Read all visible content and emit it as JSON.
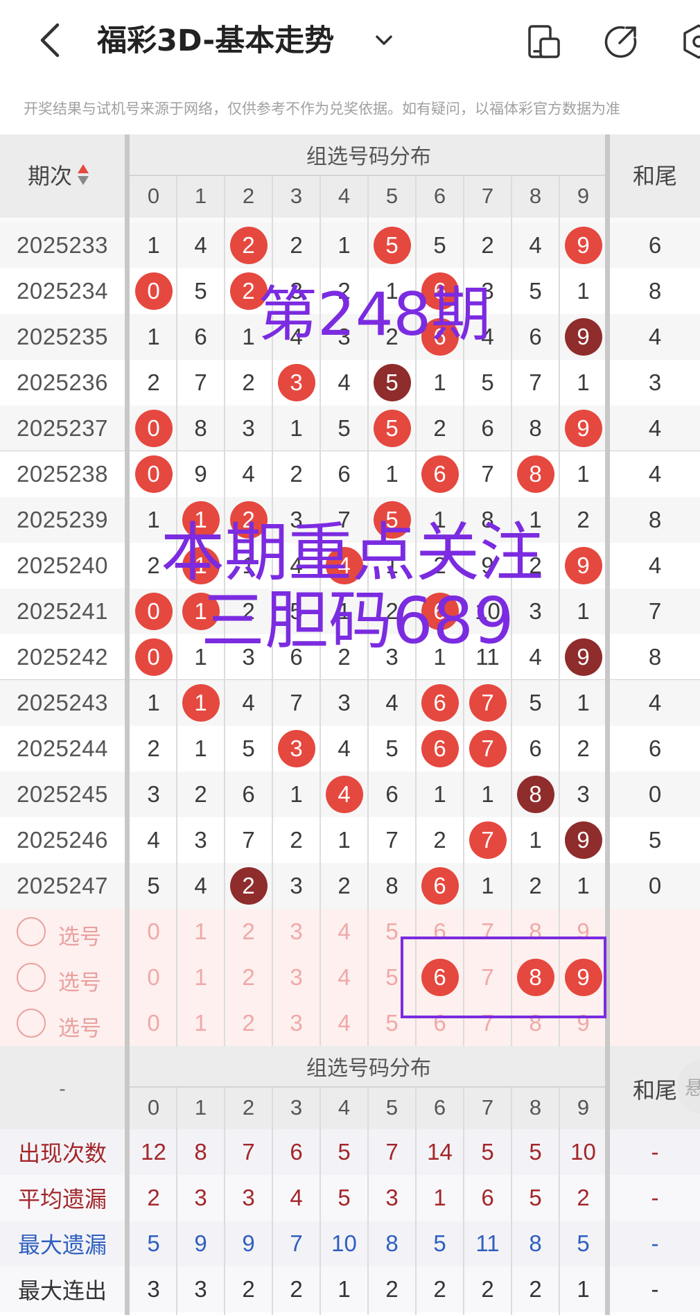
{
  "header": {
    "title": "福彩3D-基本走势",
    "back_icon": "chevron-left-icon",
    "caret_icon": "chevron-down-icon",
    "icons": [
      "phone-icon",
      "share-icon",
      "settings-icon"
    ]
  },
  "notice": "开奖结果与试机号来源于网络，仅供参考不作为兑奖依据。如有疑问，以福体彩官方数据为准",
  "table": {
    "col_issue": "期次",
    "group_title": "组选号码分布",
    "col_tail": "和尾",
    "digits": [
      "0",
      "1",
      "2",
      "3",
      "4",
      "5",
      "6",
      "7",
      "8",
      "9"
    ],
    "rows": [
      {
        "issue": "2025233",
        "cells": [
          "1",
          "4",
          "2",
          "2",
          "1",
          "5",
          "5",
          "2",
          "4",
          "9"
        ],
        "balls": [
          2,
          5,
          9
        ],
        "dark": [],
        "tail": "6"
      },
      {
        "issue": "2025234",
        "cells": [
          "0",
          "5",
          "2",
          "3",
          "2",
          "1",
          "6",
          "3",
          "5",
          "1"
        ],
        "balls": [
          0,
          2,
          6
        ],
        "dark": [],
        "tail": "8"
      },
      {
        "issue": "2025235",
        "cells": [
          "1",
          "6",
          "1",
          "4",
          "3",
          "2",
          "6",
          "4",
          "6",
          "9"
        ],
        "balls": [
          6,
          9
        ],
        "dark": [
          9
        ],
        "tail": "4"
      },
      {
        "issue": "2025236",
        "cells": [
          "2",
          "7",
          "2",
          "3",
          "4",
          "5",
          "1",
          "5",
          "7",
          "1"
        ],
        "balls": [
          3,
          5
        ],
        "dark": [
          5
        ],
        "tail": "3"
      },
      {
        "issue": "2025237",
        "cells": [
          "0",
          "8",
          "3",
          "1",
          "5",
          "5",
          "2",
          "6",
          "8",
          "9"
        ],
        "balls": [
          0,
          5,
          9
        ],
        "dark": [],
        "tail": "4"
      },
      {
        "issue": "2025238",
        "cells": [
          "0",
          "9",
          "4",
          "2",
          "6",
          "1",
          "6",
          "7",
          "8",
          "1"
        ],
        "balls": [
          0,
          6,
          8
        ],
        "dark": [],
        "tail": "4"
      },
      {
        "issue": "2025239",
        "cells": [
          "1",
          "1",
          "2",
          "3",
          "7",
          "5",
          "1",
          "8",
          "1",
          "2"
        ],
        "balls": [
          1,
          2,
          5
        ],
        "dark": [],
        "tail": "8"
      },
      {
        "issue": "2025240",
        "cells": [
          "2",
          "1",
          "1",
          "4",
          "4",
          "1",
          "2",
          "9",
          "2",
          "9"
        ],
        "balls": [
          1,
          4,
          9
        ],
        "dark": [],
        "tail": "4"
      },
      {
        "issue": "2025241",
        "cells": [
          "0",
          "1",
          "2",
          "5",
          "1",
          "2",
          "6",
          "10",
          "3",
          "1"
        ],
        "balls": [
          0,
          1,
          6
        ],
        "dark": [],
        "tail": "7"
      },
      {
        "issue": "2025242",
        "cells": [
          "0",
          "1",
          "3",
          "6",
          "2",
          "3",
          "1",
          "11",
          "4",
          "9"
        ],
        "balls": [
          0,
          9
        ],
        "dark": [
          9
        ],
        "tail": "8"
      },
      {
        "issue": "2025243",
        "cells": [
          "1",
          "1",
          "4",
          "7",
          "3",
          "4",
          "6",
          "7",
          "5",
          "1"
        ],
        "balls": [
          1,
          6,
          7
        ],
        "dark": [],
        "tail": "4"
      },
      {
        "issue": "2025244",
        "cells": [
          "2",
          "1",
          "5",
          "3",
          "4",
          "5",
          "6",
          "7",
          "6",
          "2"
        ],
        "balls": [
          3,
          6,
          7
        ],
        "dark": [],
        "tail": "6"
      },
      {
        "issue": "2025245",
        "cells": [
          "3",
          "2",
          "6",
          "1",
          "4",
          "6",
          "1",
          "1",
          "8",
          "3"
        ],
        "balls": [
          4,
          8
        ],
        "dark": [
          8
        ],
        "tail": "0"
      },
      {
        "issue": "2025246",
        "cells": [
          "4",
          "3",
          "7",
          "2",
          "1",
          "7",
          "2",
          "7",
          "1",
          "9"
        ],
        "balls": [
          7,
          9
        ],
        "dark": [
          9
        ],
        "tail": "5"
      },
      {
        "issue": "2025247",
        "cells": [
          "5",
          "4",
          "2",
          "3",
          "2",
          "8",
          "6",
          "1",
          "2",
          "1"
        ],
        "balls": [
          2,
          6
        ],
        "dark": [
          2
        ],
        "tail": "0"
      }
    ],
    "select_rows": [
      {
        "label": "选号",
        "selected": []
      },
      {
        "label": "选号",
        "selected": [
          6,
          8,
          9
        ]
      },
      {
        "label": "选号",
        "selected": []
      }
    ],
    "footer_issue": "-",
    "stats": [
      {
        "label": "出现次数",
        "values": [
          "12",
          "8",
          "7",
          "6",
          "5",
          "7",
          "14",
          "5",
          "5",
          "10"
        ],
        "tail": "-",
        "color": "#a3262a"
      },
      {
        "label": "平均遗漏",
        "values": [
          "2",
          "3",
          "3",
          "4",
          "5",
          "3",
          "1",
          "6",
          "5",
          "2"
        ],
        "tail": "-",
        "color": "#a3262a"
      },
      {
        "label": "最大遗漏",
        "values": [
          "5",
          "9",
          "9",
          "7",
          "10",
          "8",
          "5",
          "11",
          "8",
          "5"
        ],
        "tail": "-",
        "color": "#2f5fbf"
      },
      {
        "label": "最大连出",
        "values": [
          "3",
          "3",
          "2",
          "2",
          "1",
          "2",
          "2",
          "2",
          "2",
          "1"
        ],
        "tail": "-",
        "color": "#333333"
      }
    ]
  },
  "overlay": {
    "issue_text": "第248期",
    "focus_line1": "本期重点关注",
    "focus_line2": "三胆码689"
  },
  "side_peek": "悬"
}
